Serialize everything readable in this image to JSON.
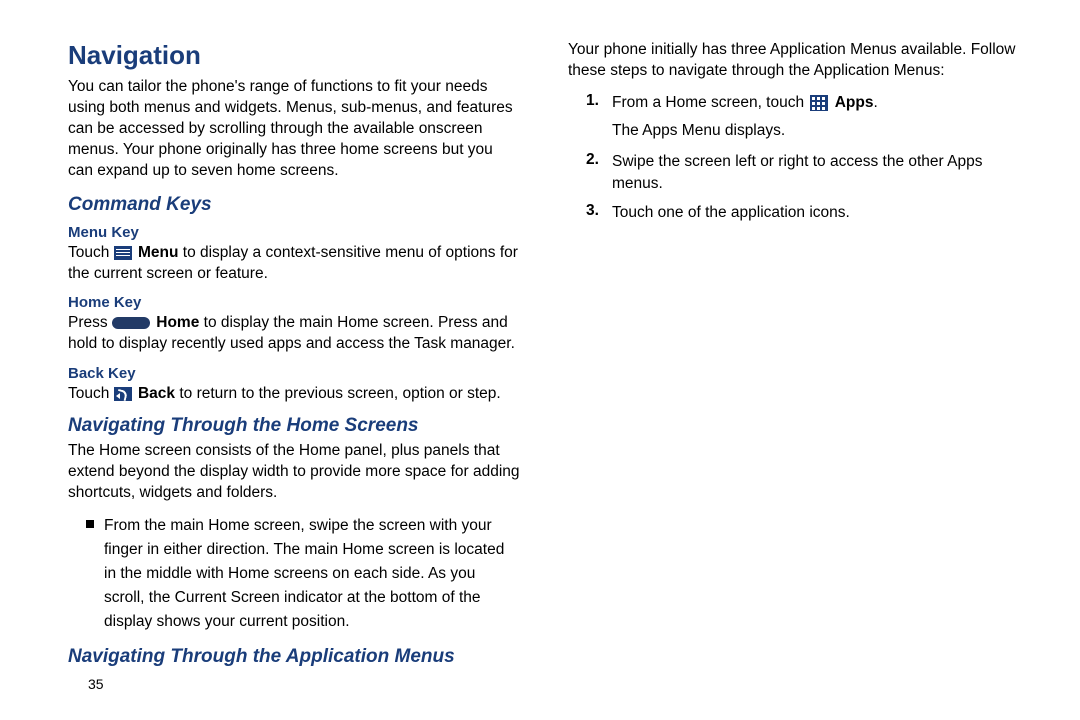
{
  "left": {
    "title": "Navigation",
    "intro": "You can tailor the phone's range of functions to fit your needs using both menus and widgets. Menus, sub-menus, and features can be accessed by scrolling through the available onscreen menus. Your phone originally has three home screens but you can expand up to seven home screens.",
    "command_keys_heading": "Command Keys",
    "menu_key_heading": "Menu Key",
    "menu_key_pre": "Touch ",
    "menu_key_bold": "Menu",
    "menu_key_post": " to display a context-sensitive menu of options for the current screen or feature.",
    "home_key_heading": "Home Key",
    "home_key_pre": "Press ",
    "home_key_bold": "Home",
    "home_key_post": " to display the main Home screen. Press and hold to display recently used apps and access the Task manager.",
    "back_key_heading": "Back Key",
    "back_key_pre": "Touch ",
    "back_key_bold": "Back",
    "back_key_post": " to return to the previous screen, option or step."
  },
  "right": {
    "nav_home_heading": "Navigating Through the Home Screens",
    "nav_home_intro": "The Home screen consists of the Home panel, plus panels that extend beyond the display width to provide more space for adding shortcuts, widgets and folders.",
    "nav_home_bullet": "From the main Home screen, swipe the screen with your finger in either direction. The main Home screen is located in the middle with Home screens on each side. As you scroll, the Current Screen indicator at the bottom of the display shows your current position.",
    "nav_app_heading": "Navigating Through the Application Menus",
    "nav_app_intro": "Your phone initially has three Application Menus available. Follow these steps to navigate through the Application Menus:",
    "step1_num": "1.",
    "step1_pre": "From a Home screen, touch ",
    "step1_bold": "Apps",
    "step1_post": ".",
    "step1_sub": "The Apps Menu displays.",
    "step2_num": "2.",
    "step2_text": "Swipe the screen left or right to access the other Apps menus.",
    "step3_num": "3.",
    "step3_text": "Touch one of the application icons."
  },
  "page_number": "35"
}
